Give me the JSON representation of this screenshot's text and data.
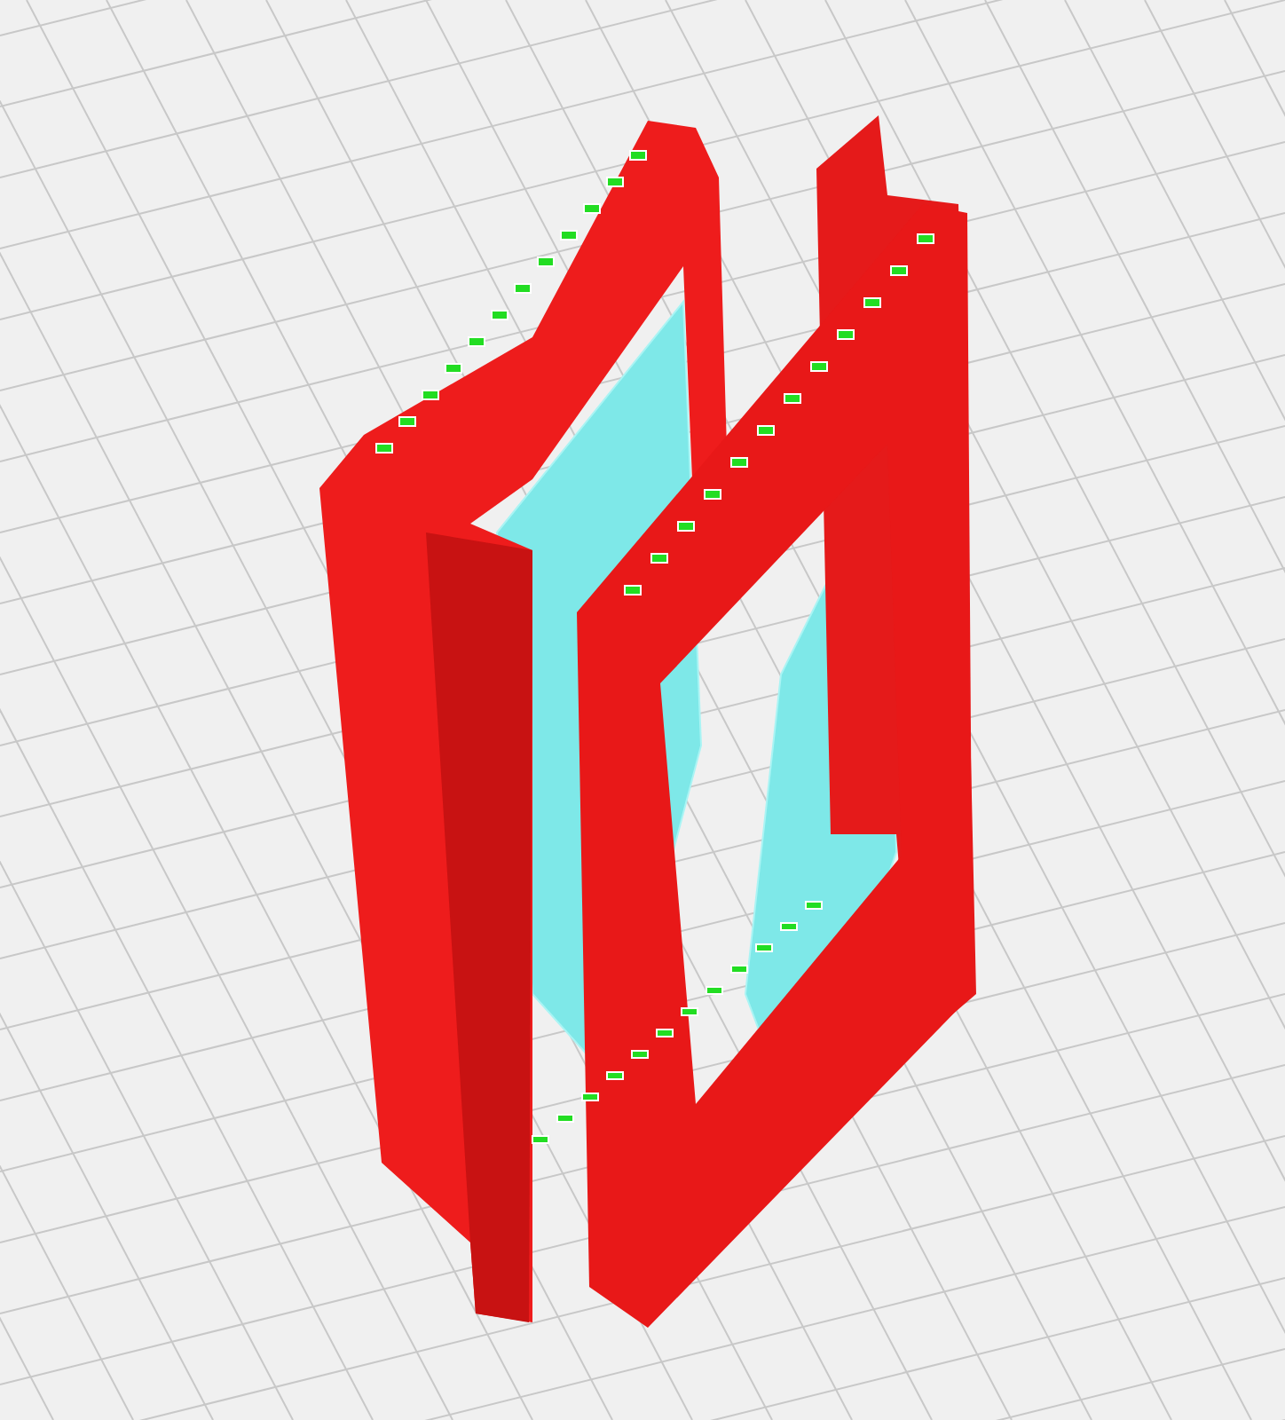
{
  "viewport": {
    "kind": "layer-view"
  }
}
